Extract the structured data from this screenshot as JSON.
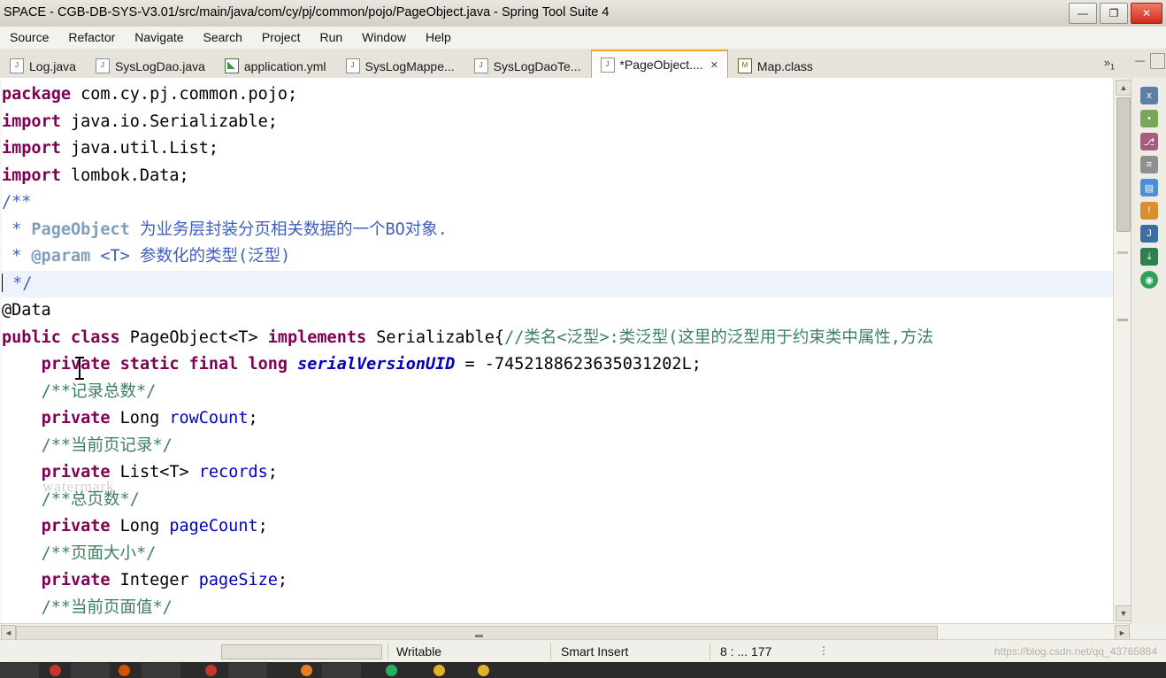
{
  "window": {
    "title": "SPACE - CGB-DB-SYS-V3.01/src/main/java/com/cy/pj/common/pojo/PageObject.java - Spring Tool Suite 4",
    "buttons": {
      "minimize": "—",
      "maximize": "❐",
      "close": "✕"
    }
  },
  "menubar": {
    "items": [
      "Source",
      "Refactor",
      "Navigate",
      "Search",
      "Project",
      "Run",
      "Window",
      "Help"
    ]
  },
  "tabs": [
    {
      "label": "Log.java",
      "icon": "java-file-icon",
      "active": false,
      "closable": false
    },
    {
      "label": "SysLogDao.java",
      "icon": "java-file-icon",
      "active": false,
      "closable": false
    },
    {
      "label": "application.yml",
      "icon": "yml-file-icon",
      "active": false,
      "closable": false
    },
    {
      "label": "SysLogMappe...",
      "icon": "xml-file-icon",
      "active": false,
      "closable": false
    },
    {
      "label": "SysLogDaoTe...",
      "icon": "java-file-icon",
      "active": false,
      "closable": false
    },
    {
      "label": "*PageObject....",
      "icon": "java-file-icon",
      "active": true,
      "closable": true,
      "close_glyph": "✕"
    },
    {
      "label": "Map.class",
      "icon": "class-file-icon",
      "active": false,
      "closable": false
    }
  ],
  "tab_overflow": {
    "glyph": "»",
    "count": "1"
  },
  "editor_controls": {
    "minimize": "—",
    "maximize": "❐"
  },
  "code_lines": [
    {
      "hl": false,
      "segments": [
        {
          "t": "package",
          "c": "kw"
        },
        {
          "t": " com.cy.pj.common.pojo;",
          "c": "plain"
        }
      ]
    },
    {
      "hl": false,
      "segments": [
        {
          "t": "import",
          "c": "kw"
        },
        {
          "t": " java.io.Serializable;",
          "c": "plain"
        }
      ]
    },
    {
      "hl": false,
      "segments": [
        {
          "t": "import",
          "c": "kw"
        },
        {
          "t": " java.util.List;",
          "c": "plain"
        }
      ]
    },
    {
      "hl": false,
      "segments": [
        {
          "t": "import",
          "c": "kw"
        },
        {
          "t": " lombok.Data;",
          "c": "plain"
        }
      ]
    },
    {
      "hl": false,
      "segments": [
        {
          "t": "/**",
          "c": "jdoc"
        }
      ]
    },
    {
      "hl": false,
      "segments": [
        {
          "t": " * ",
          "c": "jdoc"
        },
        {
          "t": "PageObject",
          "c": "jdoctag"
        },
        {
          "t": " 为业务层封装分页相关数据的一个BO对象.",
          "c": "jdoc"
        }
      ]
    },
    {
      "hl": false,
      "segments": [
        {
          "t": " * ",
          "c": "jdoc"
        },
        {
          "t": "@param",
          "c": "jdoctag"
        },
        {
          "t": " <T> 参数化的类型(泛型)",
          "c": "jdoc"
        }
      ]
    },
    {
      "hl": true,
      "segments": [
        {
          "t": " */",
          "c": "jdoc"
        }
      ]
    },
    {
      "hl": false,
      "segments": [
        {
          "t": "@Data",
          "c": "plain"
        }
      ]
    },
    {
      "hl": false,
      "segments": [
        {
          "t": "public class",
          "c": "kw"
        },
        {
          "t": " PageObject<T> ",
          "c": "plain"
        },
        {
          "t": "implements",
          "c": "kw"
        },
        {
          "t": " Serializable{",
          "c": "plain"
        },
        {
          "t": "//类名<泛型>:类泛型(这里的泛型用于约束类中属性,方法",
          "c": "cmt"
        }
      ]
    },
    {
      "hl": false,
      "segments": [
        {
          "t": "    ",
          "c": "plain"
        },
        {
          "t": "private static final",
          "c": "kw"
        },
        {
          "t": " ",
          "c": "plain"
        },
        {
          "t": "long",
          "c": "kw"
        },
        {
          "t": " ",
          "c": "plain"
        },
        {
          "t": "serialVersionUID",
          "c": "stat"
        },
        {
          "t": " = -7452188623635031202L;",
          "c": "plain"
        }
      ]
    },
    {
      "hl": false,
      "segments": [
        {
          "t": "    ",
          "c": "plain"
        },
        {
          "t": "/**记录总数*/",
          "c": "cmt"
        }
      ]
    },
    {
      "hl": false,
      "segments": [
        {
          "t": "    ",
          "c": "plain"
        },
        {
          "t": "private",
          "c": "kw"
        },
        {
          "t": " Long ",
          "c": "plain"
        },
        {
          "t": "rowCount",
          "c": "fld"
        },
        {
          "t": ";",
          "c": "plain"
        }
      ]
    },
    {
      "hl": false,
      "segments": [
        {
          "t": "    ",
          "c": "plain"
        },
        {
          "t": "/**当前页记录*/",
          "c": "cmt"
        }
      ]
    },
    {
      "hl": false,
      "segments": [
        {
          "t": "    ",
          "c": "plain"
        },
        {
          "t": "private",
          "c": "kw"
        },
        {
          "t": " List<T> ",
          "c": "plain"
        },
        {
          "t": "records",
          "c": "fld"
        },
        {
          "t": ";",
          "c": "plain"
        }
      ]
    },
    {
      "hl": false,
      "segments": [
        {
          "t": "    ",
          "c": "plain"
        },
        {
          "t": "/**总页数*/",
          "c": "cmt"
        }
      ]
    },
    {
      "hl": false,
      "segments": [
        {
          "t": "    ",
          "c": "plain"
        },
        {
          "t": "private",
          "c": "kw"
        },
        {
          "t": " Long ",
          "c": "plain"
        },
        {
          "t": "pageCount",
          "c": "fld"
        },
        {
          "t": ";",
          "c": "plain"
        }
      ]
    },
    {
      "hl": false,
      "segments": [
        {
          "t": "    ",
          "c": "plain"
        },
        {
          "t": "/**页面大小*/",
          "c": "cmt"
        }
      ]
    },
    {
      "hl": false,
      "segments": [
        {
          "t": "    ",
          "c": "plain"
        },
        {
          "t": "private",
          "c": "kw"
        },
        {
          "t": " Integer ",
          "c": "plain"
        },
        {
          "t": "pageSize",
          "c": "fld"
        },
        {
          "t": ";",
          "c": "plain"
        }
      ]
    },
    {
      "hl": false,
      "segments": [
        {
          "t": "    ",
          "c": "plain"
        },
        {
          "t": "/**当前页面值*/",
          "c": "cmt"
        }
      ]
    }
  ],
  "watermark": "watermark",
  "statusbar": {
    "writable": "Writable",
    "insert_mode": "Smart Insert",
    "position": "8 : ... 177",
    "more_glyph": "⋮",
    "csdn": "https://blog.csdn.net/qq_43765884"
  },
  "scrollbars": {
    "up_arrow": "▲",
    "down_arrow": "▼",
    "left_arrow": "◄",
    "right_arrow": "►",
    "grip": "▬"
  },
  "colors": {
    "keyword": "#7f0055",
    "comment": "#3f7f5f",
    "javadoc": "#3f5fbf",
    "field": "#0000c0",
    "accent_tab": "#f5a623",
    "selection": "#eef3fb"
  }
}
